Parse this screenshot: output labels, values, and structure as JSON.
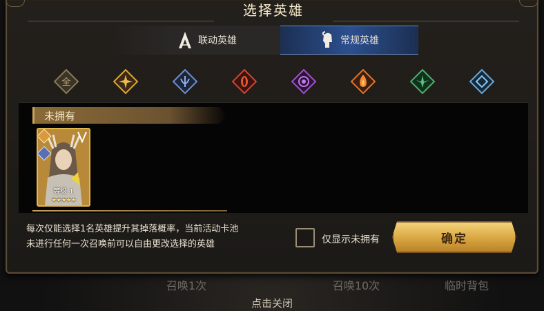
{
  "dialog": {
    "title": "选择英雄",
    "tabs": [
      {
        "label": "联动英雄",
        "icon": "assassin-creed-icon",
        "active": false
      },
      {
        "label": "常规英雄",
        "icon": "spartan-helmet-icon",
        "active": true
      }
    ],
    "filters": [
      {
        "icon": "all-filter-icon",
        "label": "全",
        "color": "#8a7a55"
      },
      {
        "icon": "light-element-icon",
        "color": "#e2a33b"
      },
      {
        "icon": "water-element-icon",
        "color": "#6c8fcf"
      },
      {
        "icon": "blood-element-icon",
        "color": "#d4442e"
      },
      {
        "icon": "void-element-icon",
        "color": "#a14fcf"
      },
      {
        "icon": "fire-element-icon",
        "color": "#e0752c"
      },
      {
        "icon": "nature-element-icon",
        "color": "#4bb06a"
      },
      {
        "icon": "ice-element-icon",
        "color": "#6aa8d8"
      }
    ],
    "section_label": "未拥有",
    "heroes": [
      {
        "level_label": "等级",
        "level": "1",
        "stars": "★★★★★"
      }
    ],
    "description_lines": [
      "每次仅能选择1名英雄提升其掉落概率，当前活动卡池",
      "未进行任何一次召唤前可以自由更改选择的英雄"
    ],
    "checkbox_label": "仅显示未拥有",
    "checkbox_checked": false,
    "confirm_label": "确定"
  },
  "background_tabs": [
    "召唤1次",
    "召唤10次",
    "临时背包"
  ],
  "close_hint": "点击关闭"
}
